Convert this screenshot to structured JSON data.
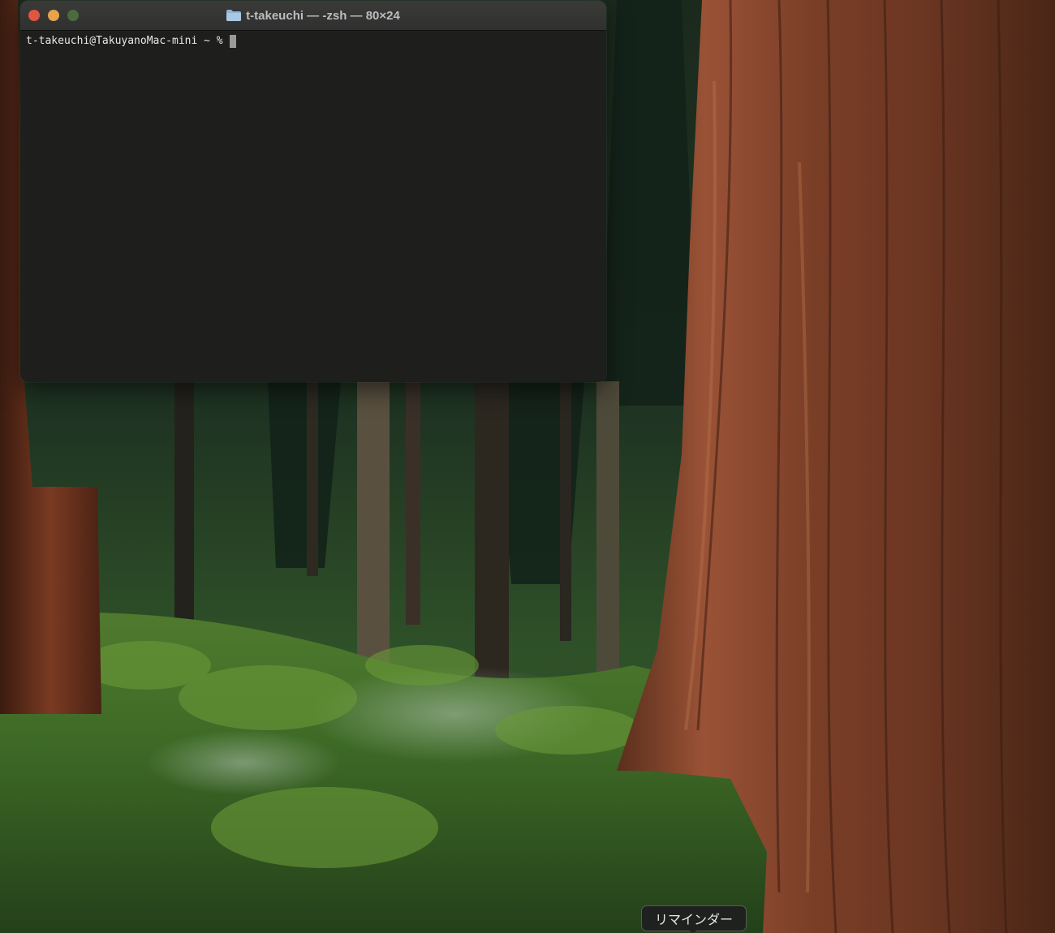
{
  "terminal": {
    "title": "t-takeuchi — -zsh — 80×24",
    "prompt": "t-takeuchi@TakuyanoMac-mini ~ % ",
    "buttons": {
      "close_color": "#e0563f",
      "minimize_color": "#e6a34a",
      "zoom_color": "#4b6a3e"
    },
    "title_icon": "folder-icon"
  },
  "dock": {
    "tooltip_label": "リマインダー"
  },
  "wallpaper": {
    "subject": "sequoia-forest-icon"
  }
}
